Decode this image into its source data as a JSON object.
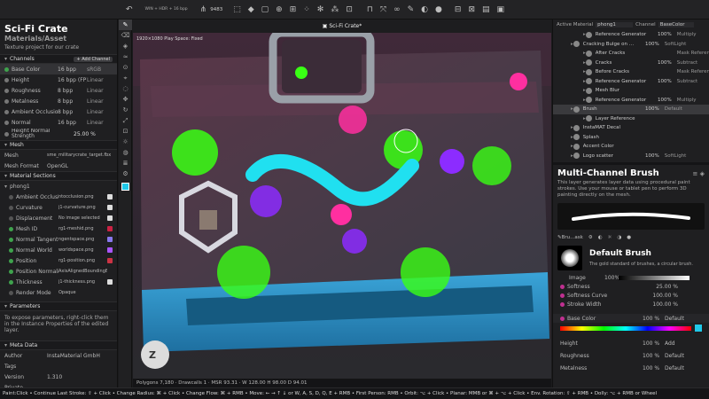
{
  "topbar": {
    "resolution": "WIN + HDR + 16 bpp",
    "counter": "9483"
  },
  "project": {
    "title": "Sci-Fi Crate",
    "subtitle": "Materials/Asset",
    "description": "Texture project for our crate"
  },
  "channels": {
    "header": "Channels",
    "add_button": "+ Add Channel",
    "rows": [
      {
        "name": "Base Color",
        "depth": "16 bpp",
        "space": "sRGB",
        "color": "#3fa34d",
        "selected": true
      },
      {
        "name": "Height",
        "depth": "16 bpp (FP)",
        "space": "Linear",
        "color": "#777777",
        "selected": false
      },
      {
        "name": "Roughness",
        "depth": "8 bpp",
        "space": "Linear",
        "color": "#777777",
        "selected": false
      },
      {
        "name": "Metalness",
        "depth": "8 bpp",
        "space": "Linear",
        "color": "#777777",
        "selected": false
      },
      {
        "name": "Ambient Occlusion",
        "depth": "8 bpp",
        "space": "Linear",
        "color": "#777777",
        "selected": false
      },
      {
        "name": "Normal",
        "depth": "16 bpp",
        "space": "Linear",
        "color": "#777777",
        "selected": false
      }
    ],
    "height_strength_label": "Height Normal Strength",
    "height_strength_value": "25.00 %"
  },
  "mesh": {
    "header": "Mesh",
    "mesh_label": "Mesh",
    "mesh_value": "sme_militarycrate_target.fbx",
    "format_label": "Mesh Format",
    "format_value": "OpenGL"
  },
  "material_sections": {
    "header": "Material Sections",
    "material": "phong1",
    "rows": [
      {
        "name": "Ambient Occlusion",
        "value": "ntocclusion.png",
        "color": "#555555",
        "swatch": "#dddddd"
      },
      {
        "name": "Curvature",
        "value": "j1-curvature.png",
        "color": "#555555",
        "swatch": "#dddddd"
      },
      {
        "name": "Displacement",
        "value": "No image selected",
        "color": "#555555",
        "swatch": "#dddddd"
      },
      {
        "name": "Mesh ID",
        "value": "rg1-meshid.png",
        "color": "#3fa34d",
        "swatch": "#cc2244"
      },
      {
        "name": "Normal Tangent",
        "value": "ngentspace.png",
        "color": "#3fa34d",
        "swatch": "#8877ee"
      },
      {
        "name": "Normal World",
        "value": "worldspace.png",
        "color": "#3fa34d",
        "swatch": "#aa55ff"
      },
      {
        "name": "Position",
        "value": "rg1-position.png",
        "color": "#3fa34d",
        "swatch": "#cc3344"
      },
      {
        "name": "Position Normalization",
        "value": "AxisAlignedBoundingB",
        "color": "#3fa34d",
        "swatch": ""
      },
      {
        "name": "Thickness",
        "value": "j1-thickness.png",
        "color": "#3fa34d",
        "swatch": "#dddddd"
      },
      {
        "name": "Render Mode",
        "value": "Opaque",
        "color": "#555555",
        "swatch": ""
      }
    ]
  },
  "parameters": {
    "header": "Parameters",
    "hint": "To expose parameters, right-click them in the Instance Properties of the edited layer."
  },
  "meta": {
    "header": "Meta Data",
    "rows": [
      {
        "k": "Author",
        "v": "InstaMaterial GmbH"
      },
      {
        "k": "Tags",
        "v": ""
      },
      {
        "k": "Version",
        "v": "1.310"
      },
      {
        "k": "Private",
        "v": ""
      }
    ]
  },
  "viewport": {
    "tab": "Sci-Fi Crate*",
    "overlay": "1920×1080 Play Space: Fixed",
    "stats": "Polygons 7,180 · Drawcalls 1 · MSR 93.31 · W 128.00 H 98.00 D 94.01"
  },
  "layers_header": {
    "active_label": "Active Material",
    "active_value": "phong1",
    "channel_label": "Channel",
    "channel_value": "BaseColor"
  },
  "layers": [
    {
      "indent": 2,
      "name": "Reference Generator",
      "op": "100%",
      "blend": "Multiply",
      "hl": false
    },
    {
      "indent": 1,
      "name": "Cracking Bulge on …",
      "op": "100%",
      "blend": "SoftLight",
      "hl": false
    },
    {
      "indent": 2,
      "name": "After Cracks",
      "op": "",
      "blend": "Mask Reference",
      "hl": false
    },
    {
      "indent": 2,
      "name": "Cracks",
      "op": "100%",
      "blend": "Subtract",
      "hl": false
    },
    {
      "indent": 2,
      "name": "Before Cracks",
      "op": "",
      "blend": "Mask Reference",
      "hl": false
    },
    {
      "indent": 2,
      "name": "Reference Generator",
      "op": "100%",
      "blend": "Subtract",
      "hl": false
    },
    {
      "indent": 2,
      "name": "Mesh Blur",
      "op": "",
      "blend": "",
      "hl": false
    },
    {
      "indent": 2,
      "name": "Reference Generator",
      "op": "100%",
      "blend": "Multiply",
      "hl": false
    },
    {
      "indent": 1,
      "name": "Brush",
      "op": "100%",
      "blend": "Default",
      "hl": true
    },
    {
      "indent": 2,
      "name": "Layer Reference",
      "op": "",
      "blend": "",
      "hl": false
    },
    {
      "indent": 1,
      "name": "InstaMAT Decal",
      "op": "",
      "blend": "",
      "hl": false
    },
    {
      "indent": 1,
      "name": "Splash",
      "op": "",
      "blend": "",
      "hl": false
    },
    {
      "indent": 1,
      "name": "Accent Color",
      "op": "",
      "blend": "",
      "hl": false
    },
    {
      "indent": 1,
      "name": "Logo scatter",
      "op": "100%",
      "blend": "SoftLight",
      "hl": false
    }
  ],
  "brush": {
    "title": "Multi-Channel Brush",
    "description": "This layer generates layer data using procedural paint strokes. Use your mouse or tablet pen to perform 3D painting directly on the mesh.",
    "toolbar_label": "Bru...ask",
    "preset_name": "Default Brush",
    "preset_desc": "The gold standard of brushes, a circular brush.",
    "image_label": "Image",
    "image_value": "100%",
    "softness_label": "Softness",
    "softness_value": "25.00 %",
    "softness_curve_label": "Softness Curve",
    "softness_curve_value": "100.00 %",
    "stroke_width_label": "Stroke Width",
    "stroke_width_value": "100.00 %",
    "base_color_label": "Base Color",
    "base_color_value": "100 %",
    "base_color_mode": "Default",
    "height_label": "Height",
    "height_value": "100 %",
    "height_mode": "Add",
    "roughness_label": "Roughness",
    "roughness_value": "100 %",
    "roughness_mode": "Default",
    "metalness_label": "Metalness",
    "metalness_value": "100 %",
    "metalness_mode": "Default",
    "accent": "#20c8e8"
  },
  "statusbar": "Paint:Click • Continue Last Stroke: ⇧ + Click • Change Radius: ⌘ + Click • Change Flow: ⌘ + RMB • Move: ← → ↑ ↓ or W, A, S, D, Q, E + RMB • First Person: RMB • Orbit: ⌥ + Click • Planar: MMB or ⌘ + ⌥ + Click • Env. Rotation: ⇧ + RMB • Dolly: ⌥ + RMB or Wheel"
}
